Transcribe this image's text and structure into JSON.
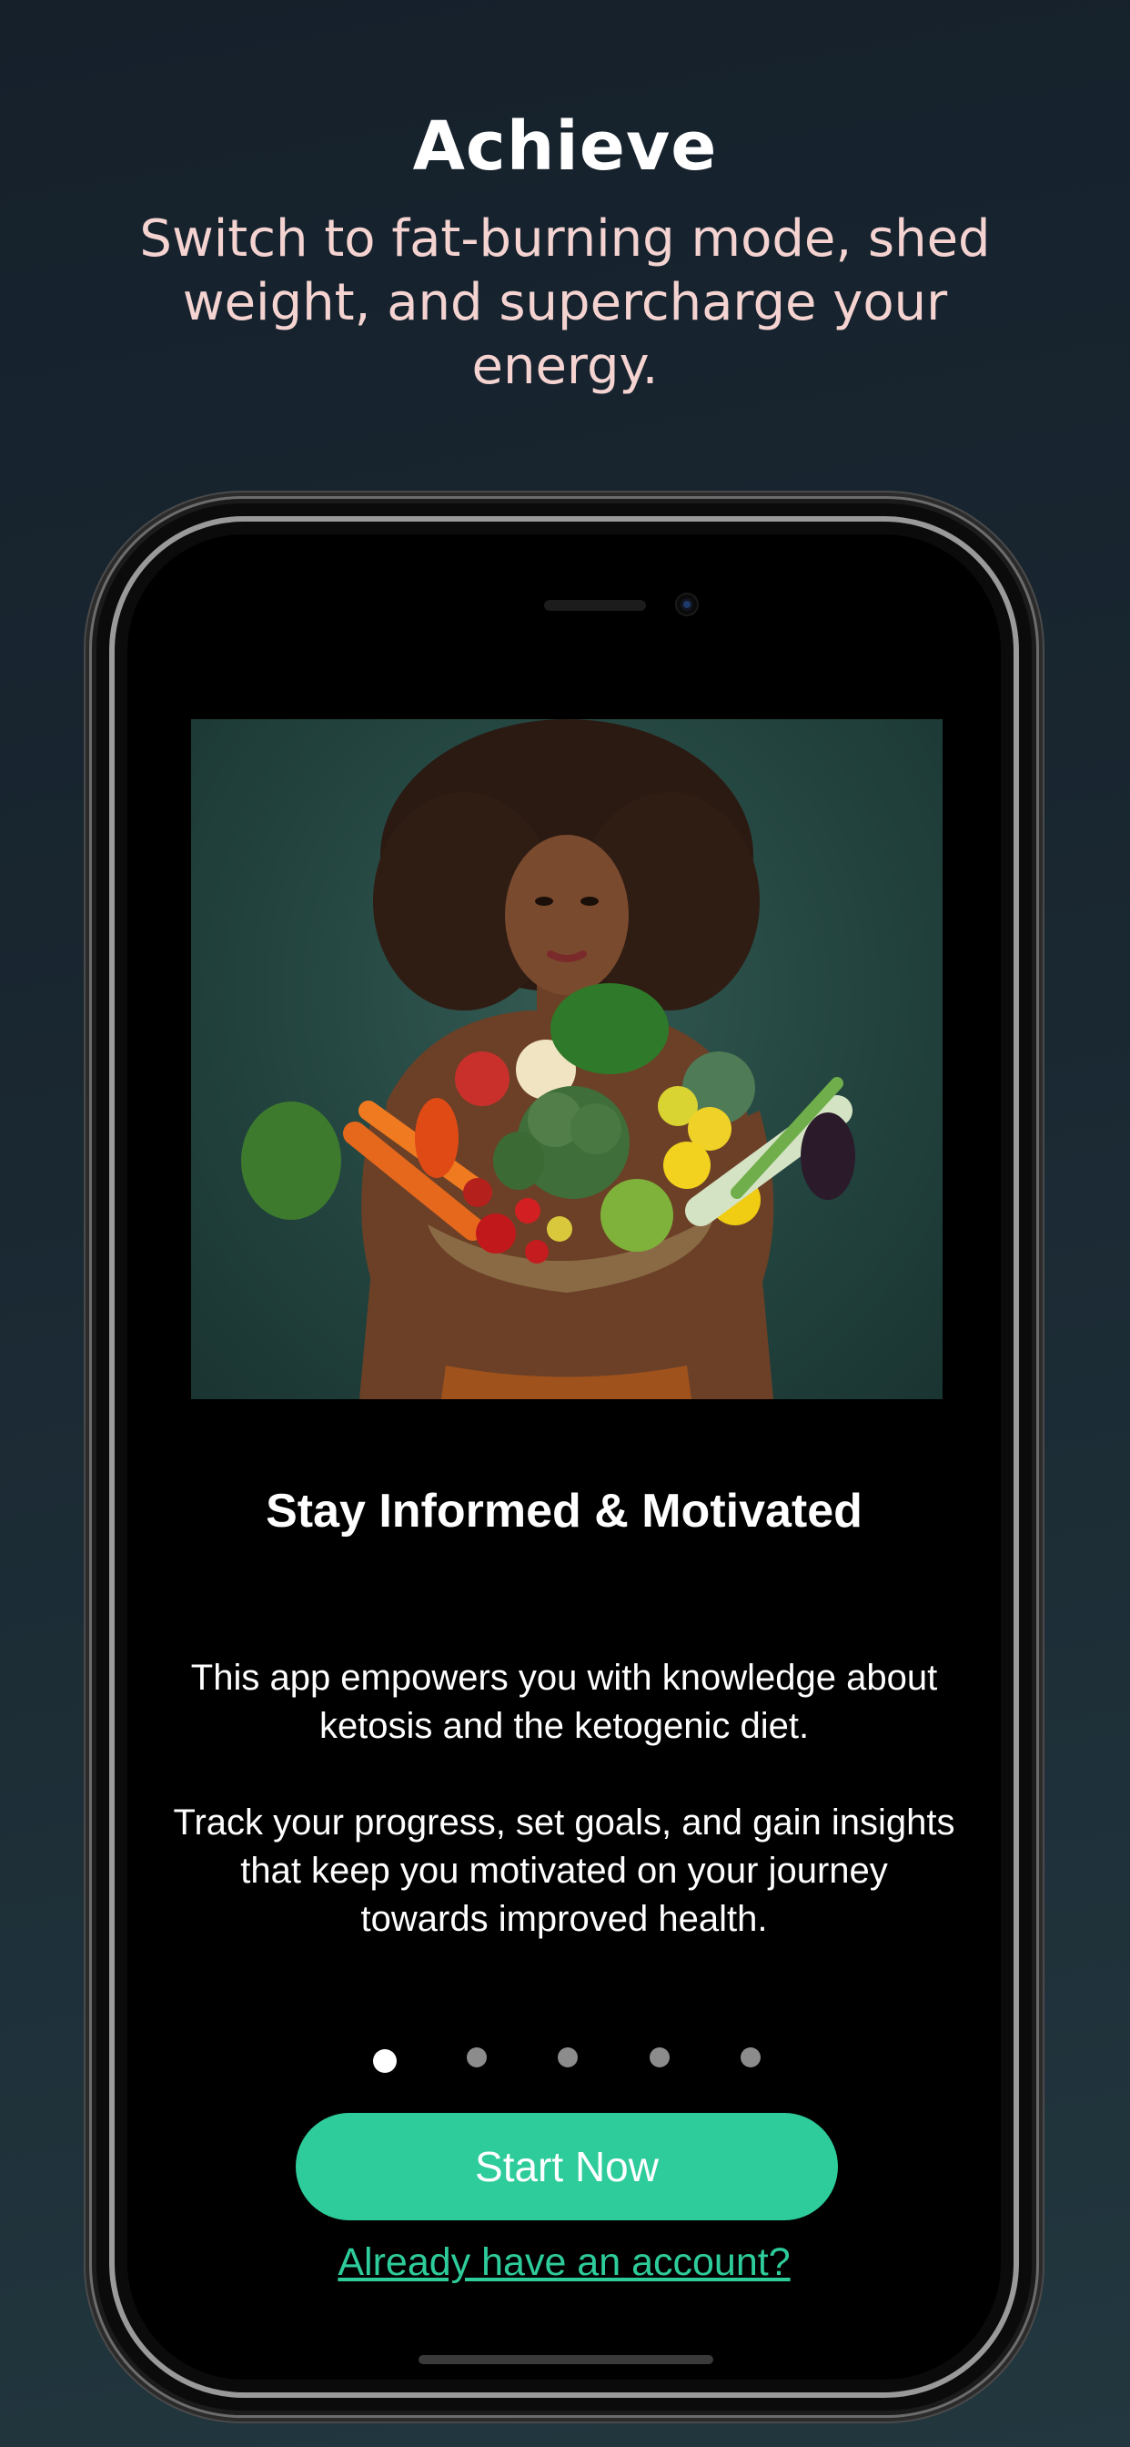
{
  "header": {
    "title": "Achieve",
    "subtitle": "Switch to fat-burning mode, shed weight, and supercharge your energy."
  },
  "onboarding": {
    "title": "Stay Informed & Motivated",
    "paragraphs": [
      "This app empowers you with knowledge about ketosis and the ketogenic diet.",
      "Track your progress, set goals, and gain insights that keep you motivated on your journey towards improved health."
    ],
    "page_indicator": {
      "total": 5,
      "active": 1
    },
    "start_button_label": "Start Now",
    "login_link_label": "Already have an account?"
  },
  "colors": {
    "accent": "#2ecc9a",
    "subtitle": "#f4d3d1",
    "background": "#1a2832"
  }
}
